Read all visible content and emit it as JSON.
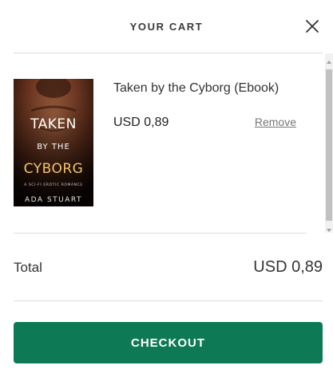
{
  "header": {
    "title": "YOUR CART",
    "close_icon": "close-icon"
  },
  "cart": {
    "items": [
      {
        "title": "Taken by the Cyborg (Ebook)",
        "price": "USD 0,89",
        "remove_label": "Remove",
        "cover": {
          "title_line1": "TAKEN",
          "title_line2": "BY THE",
          "title_line3": "CYBORG",
          "tagline": "A SCI-FI EROTIC ROMANCE",
          "author": "ADA STUART"
        }
      }
    ]
  },
  "summary": {
    "total_label": "Total",
    "total_value": "USD 0,89"
  },
  "actions": {
    "checkout_label": "CHECKOUT"
  },
  "colors": {
    "accent": "#0e7a55",
    "divider": "#dcdcdc",
    "cover_text": "#f2c46a"
  }
}
